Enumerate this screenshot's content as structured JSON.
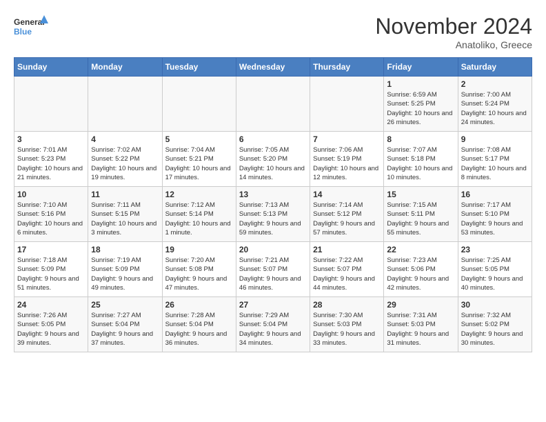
{
  "logo": {
    "text_general": "General",
    "text_blue": "Blue"
  },
  "title": "November 2024",
  "subtitle": "Anatoliko, Greece",
  "headers": [
    "Sunday",
    "Monday",
    "Tuesday",
    "Wednesday",
    "Thursday",
    "Friday",
    "Saturday"
  ],
  "weeks": [
    [
      {
        "day": "",
        "info": ""
      },
      {
        "day": "",
        "info": ""
      },
      {
        "day": "",
        "info": ""
      },
      {
        "day": "",
        "info": ""
      },
      {
        "day": "",
        "info": ""
      },
      {
        "day": "1",
        "info": "Sunrise: 6:59 AM\nSunset: 5:25 PM\nDaylight: 10 hours and 26 minutes."
      },
      {
        "day": "2",
        "info": "Sunrise: 7:00 AM\nSunset: 5:24 PM\nDaylight: 10 hours and 24 minutes."
      }
    ],
    [
      {
        "day": "3",
        "info": "Sunrise: 7:01 AM\nSunset: 5:23 PM\nDaylight: 10 hours and 21 minutes."
      },
      {
        "day": "4",
        "info": "Sunrise: 7:02 AM\nSunset: 5:22 PM\nDaylight: 10 hours and 19 minutes."
      },
      {
        "day": "5",
        "info": "Sunrise: 7:04 AM\nSunset: 5:21 PM\nDaylight: 10 hours and 17 minutes."
      },
      {
        "day": "6",
        "info": "Sunrise: 7:05 AM\nSunset: 5:20 PM\nDaylight: 10 hours and 14 minutes."
      },
      {
        "day": "7",
        "info": "Sunrise: 7:06 AM\nSunset: 5:19 PM\nDaylight: 10 hours and 12 minutes."
      },
      {
        "day": "8",
        "info": "Sunrise: 7:07 AM\nSunset: 5:18 PM\nDaylight: 10 hours and 10 minutes."
      },
      {
        "day": "9",
        "info": "Sunrise: 7:08 AM\nSunset: 5:17 PM\nDaylight: 10 hours and 8 minutes."
      }
    ],
    [
      {
        "day": "10",
        "info": "Sunrise: 7:10 AM\nSunset: 5:16 PM\nDaylight: 10 hours and 6 minutes."
      },
      {
        "day": "11",
        "info": "Sunrise: 7:11 AM\nSunset: 5:15 PM\nDaylight: 10 hours and 3 minutes."
      },
      {
        "day": "12",
        "info": "Sunrise: 7:12 AM\nSunset: 5:14 PM\nDaylight: 10 hours and 1 minute."
      },
      {
        "day": "13",
        "info": "Sunrise: 7:13 AM\nSunset: 5:13 PM\nDaylight: 9 hours and 59 minutes."
      },
      {
        "day": "14",
        "info": "Sunrise: 7:14 AM\nSunset: 5:12 PM\nDaylight: 9 hours and 57 minutes."
      },
      {
        "day": "15",
        "info": "Sunrise: 7:15 AM\nSunset: 5:11 PM\nDaylight: 9 hours and 55 minutes."
      },
      {
        "day": "16",
        "info": "Sunrise: 7:17 AM\nSunset: 5:10 PM\nDaylight: 9 hours and 53 minutes."
      }
    ],
    [
      {
        "day": "17",
        "info": "Sunrise: 7:18 AM\nSunset: 5:09 PM\nDaylight: 9 hours and 51 minutes."
      },
      {
        "day": "18",
        "info": "Sunrise: 7:19 AM\nSunset: 5:09 PM\nDaylight: 9 hours and 49 minutes."
      },
      {
        "day": "19",
        "info": "Sunrise: 7:20 AM\nSunset: 5:08 PM\nDaylight: 9 hours and 47 minutes."
      },
      {
        "day": "20",
        "info": "Sunrise: 7:21 AM\nSunset: 5:07 PM\nDaylight: 9 hours and 46 minutes."
      },
      {
        "day": "21",
        "info": "Sunrise: 7:22 AM\nSunset: 5:07 PM\nDaylight: 9 hours and 44 minutes."
      },
      {
        "day": "22",
        "info": "Sunrise: 7:23 AM\nSunset: 5:06 PM\nDaylight: 9 hours and 42 minutes."
      },
      {
        "day": "23",
        "info": "Sunrise: 7:25 AM\nSunset: 5:05 PM\nDaylight: 9 hours and 40 minutes."
      }
    ],
    [
      {
        "day": "24",
        "info": "Sunrise: 7:26 AM\nSunset: 5:05 PM\nDaylight: 9 hours and 39 minutes."
      },
      {
        "day": "25",
        "info": "Sunrise: 7:27 AM\nSunset: 5:04 PM\nDaylight: 9 hours and 37 minutes."
      },
      {
        "day": "26",
        "info": "Sunrise: 7:28 AM\nSunset: 5:04 PM\nDaylight: 9 hours and 36 minutes."
      },
      {
        "day": "27",
        "info": "Sunrise: 7:29 AM\nSunset: 5:04 PM\nDaylight: 9 hours and 34 minutes."
      },
      {
        "day": "28",
        "info": "Sunrise: 7:30 AM\nSunset: 5:03 PM\nDaylight: 9 hours and 33 minutes."
      },
      {
        "day": "29",
        "info": "Sunrise: 7:31 AM\nSunset: 5:03 PM\nDaylight: 9 hours and 31 minutes."
      },
      {
        "day": "30",
        "info": "Sunrise: 7:32 AM\nSunset: 5:02 PM\nDaylight: 9 hours and 30 minutes."
      }
    ]
  ]
}
